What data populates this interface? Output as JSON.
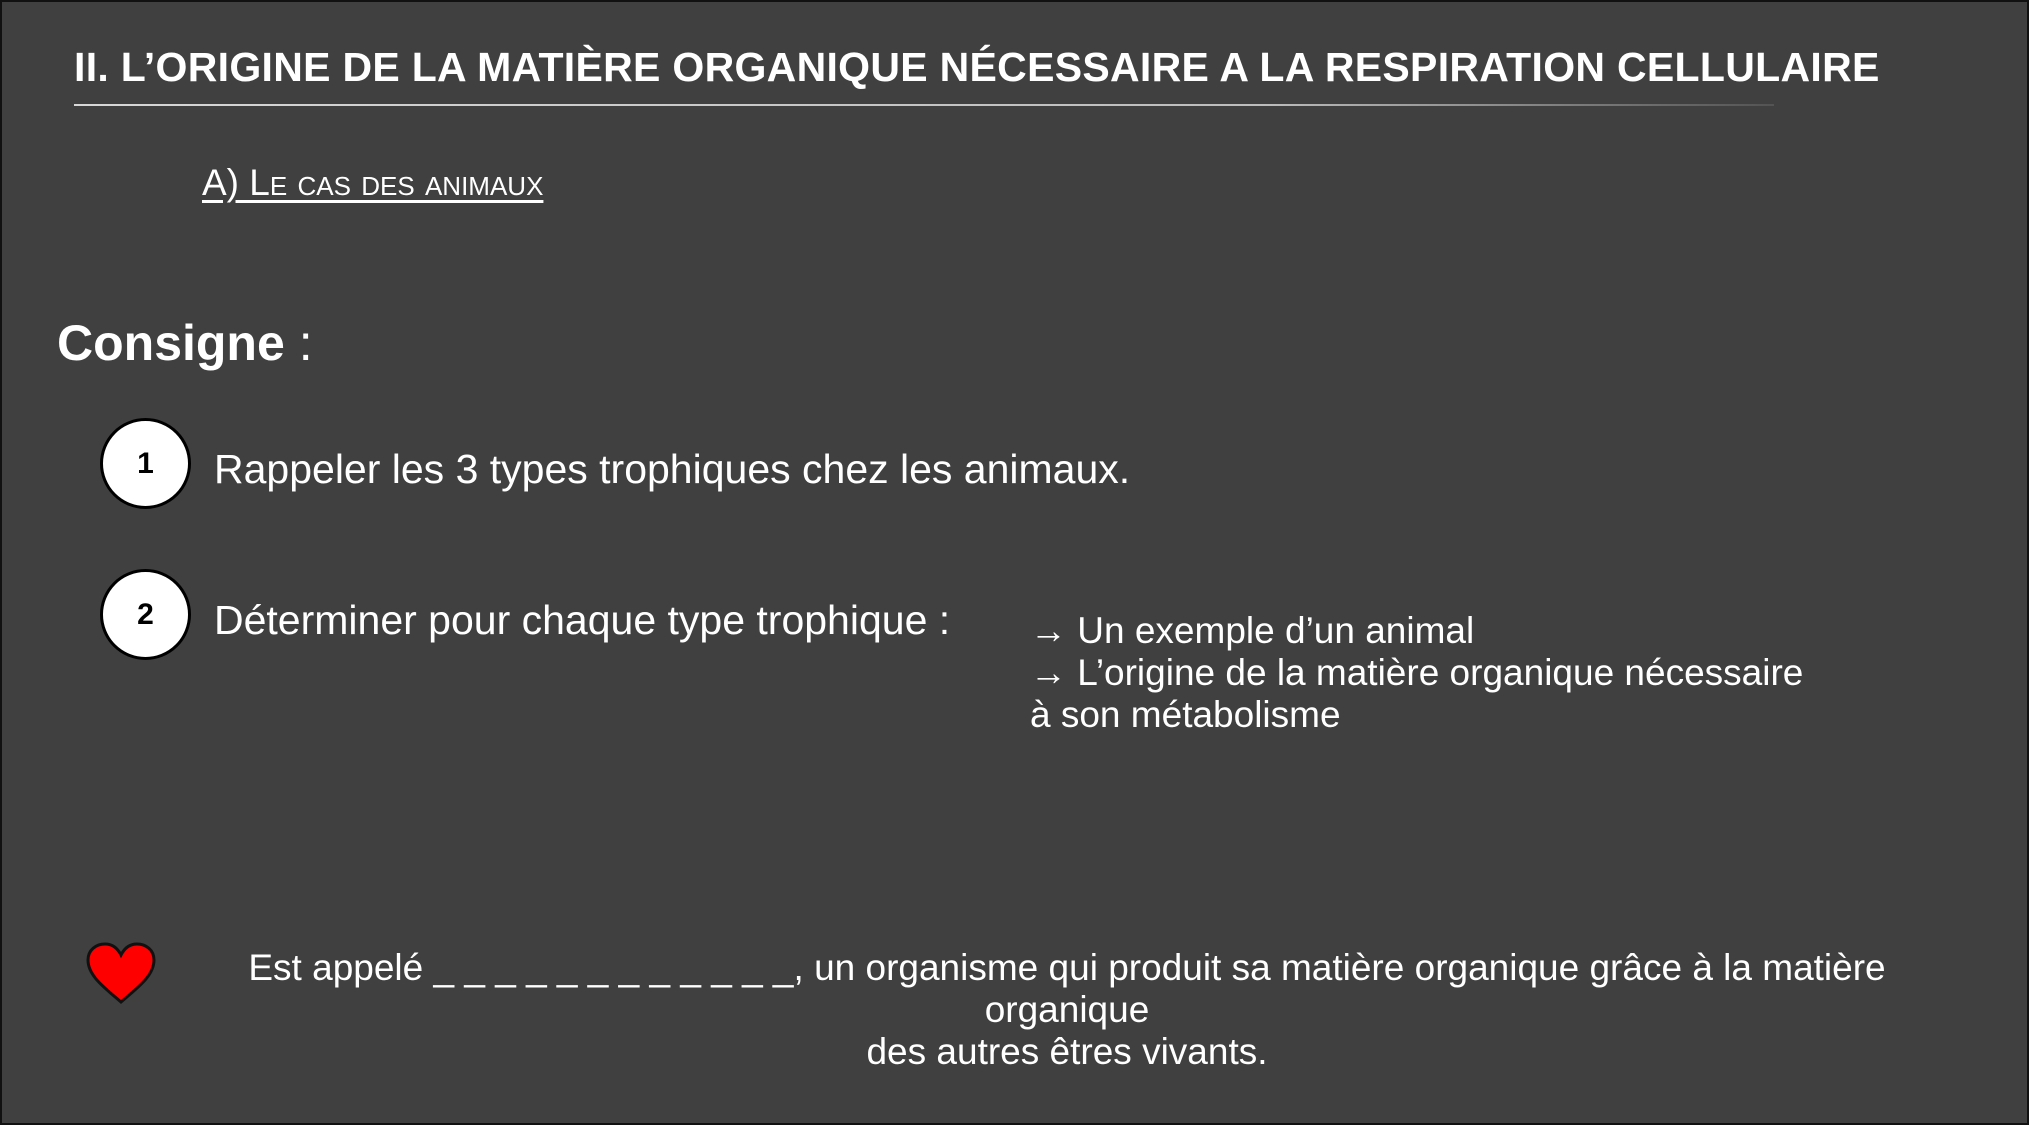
{
  "slide": {
    "title": "II. L’ORIGINE DE LA MATIÈRE ORGANIQUE NÉCESSAIRE A LA RESPIRATION CELLULAIRE",
    "subtitle": "A) Le cas des animaux",
    "consigne_label": "Consigne",
    "consigne_colon": " :",
    "steps": [
      {
        "number": "1",
        "text": "Rappeler les 3 types trophiques chez les animaux."
      },
      {
        "number": "2",
        "text": "Déterminer pour chaque type trophique :"
      }
    ],
    "details": [
      "→ Un exemple d’un animal",
      "→ L’origine de la matière organique nécessaire",
      "à son métabolisme"
    ],
    "definition": {
      "line1": "Est appelé _ _ _ _ _ _ _ _ _ _ _ _, un organisme qui produit sa matière organique grâce à la matière organique",
      "line2": "des autres êtres vivants."
    },
    "icons": {
      "heart": "heart-icon"
    },
    "colors": {
      "background": "#404040",
      "text": "#ffffff",
      "heart": "#ff0000"
    }
  }
}
